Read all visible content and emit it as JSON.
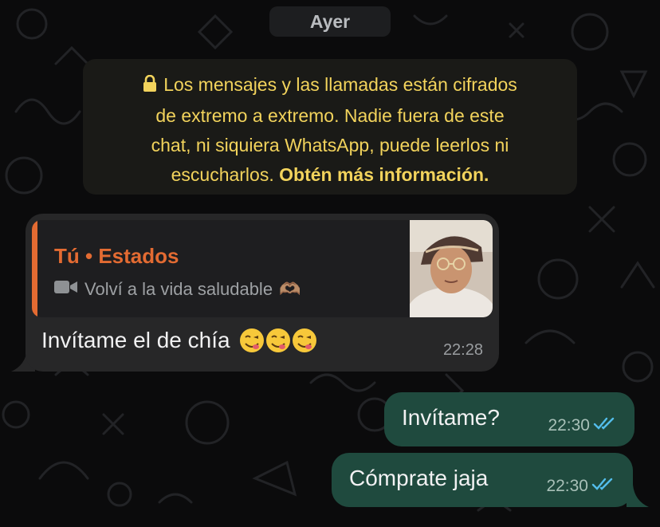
{
  "date_separator": "Ayer",
  "encryption_notice": {
    "line1": "Los mensajes y las llamadas están cifrados",
    "line2": "de extremo a extremo. Nadie fuera de este",
    "line3": "chat, ni siquiera WhatsApp, puede leerlos ni",
    "line4_prefix": "escucharlos.",
    "link": "Obtén más información."
  },
  "incoming_message": {
    "quoted": {
      "author": "Tú • Estados",
      "caption": "Volví a la vida saludable",
      "caption_emoji": "🫶🏽",
      "media_icon": "video-camera-icon",
      "thumbnail": "status-photo-thumbnail"
    },
    "text": "Invítame el de chía",
    "emojis": "😋😋😋",
    "time": "22:28"
  },
  "outgoing_messages": [
    {
      "text": "Invítame?",
      "time": "22:30",
      "status": "read",
      "status_icon": "double-check-icon"
    },
    {
      "text": "Cómprate jaja",
      "time": "22:30",
      "status": "read",
      "status_icon": "double-check-icon"
    }
  ],
  "colors": {
    "background": "#0b0b0c",
    "notice_text": "#f2d35c",
    "quote_accent": "#e36b32",
    "incoming_bubble": "#272728",
    "outgoing_bubble": "#1f4a3e",
    "read_ticks": "#53bdeb"
  }
}
